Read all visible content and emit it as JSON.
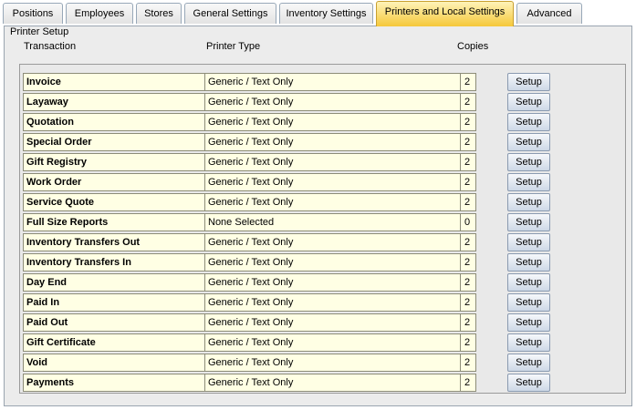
{
  "tabs": [
    {
      "label": "Positions",
      "active": false
    },
    {
      "label": "Employees",
      "active": false
    },
    {
      "label": "Stores",
      "active": false
    },
    {
      "label": "General Settings",
      "active": false
    },
    {
      "label": "Inventory Settings",
      "active": false
    },
    {
      "label": "Printers and Local Settings",
      "active": true
    },
    {
      "label": "Advanced",
      "active": false
    }
  ],
  "group_title": "Printer Setup",
  "columns": {
    "transaction": "Transaction",
    "printer_type": "Printer Type",
    "copies": "Copies"
  },
  "setup_label": "Setup",
  "rows": [
    {
      "transaction": "Invoice",
      "printer_type": "Generic / Text Only",
      "copies": "2"
    },
    {
      "transaction": "Layaway",
      "printer_type": "Generic / Text Only",
      "copies": "2"
    },
    {
      "transaction": "Quotation",
      "printer_type": "Generic / Text Only",
      "copies": "2"
    },
    {
      "transaction": "Special Order",
      "printer_type": "Generic / Text Only",
      "copies": "2"
    },
    {
      "transaction": "Gift Registry",
      "printer_type": "Generic / Text Only",
      "copies": "2"
    },
    {
      "transaction": "Work Order",
      "printer_type": "Generic / Text Only",
      "copies": "2"
    },
    {
      "transaction": "Service Quote",
      "printer_type": "Generic / Text Only",
      "copies": "2"
    },
    {
      "transaction": "Full Size Reports",
      "printer_type": "None Selected",
      "copies": "0"
    },
    {
      "transaction": "Inventory Transfers Out",
      "printer_type": "Generic / Text Only",
      "copies": "2"
    },
    {
      "transaction": "Inventory Transfers In",
      "printer_type": "Generic / Text Only",
      "copies": "2"
    },
    {
      "transaction": "Day End",
      "printer_type": "Generic / Text Only",
      "copies": "2"
    },
    {
      "transaction": "Paid In",
      "printer_type": "Generic / Text Only",
      "copies": "2"
    },
    {
      "transaction": "Paid Out",
      "printer_type": "Generic / Text Only",
      "copies": "2"
    },
    {
      "transaction": "Gift Certificate",
      "printer_type": "Generic / Text Only",
      "copies": "2"
    },
    {
      "transaction": "Void",
      "printer_type": "Generic / Text Only",
      "copies": "2"
    },
    {
      "transaction": "Payments",
      "printer_type": "Generic / Text Only",
      "copies": "2"
    }
  ]
}
